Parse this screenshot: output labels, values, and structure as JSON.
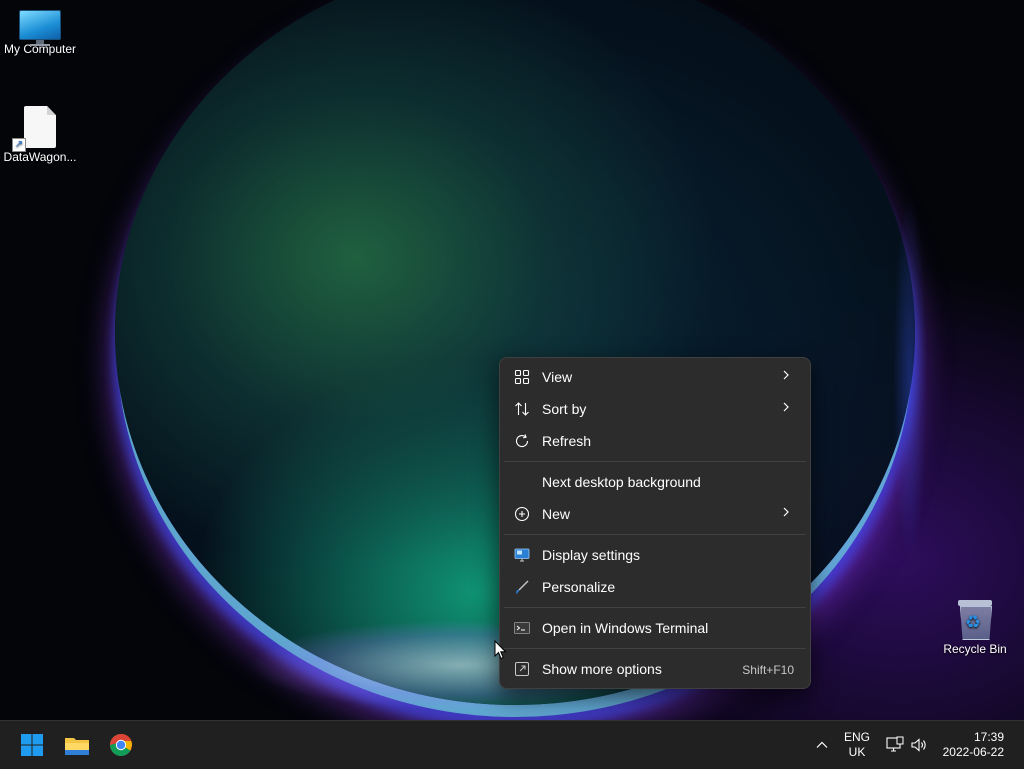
{
  "desktop": {
    "icons": [
      {
        "name": "My Computer",
        "label": "My Computer"
      },
      {
        "name": "DataWagon shortcut",
        "label": "DataWagon..."
      },
      {
        "name": "Recycle Bin",
        "label": "Recycle Bin"
      }
    ]
  },
  "context_menu": {
    "items": [
      {
        "label": "View",
        "icon": "grid-icon",
        "submenu": true
      },
      {
        "label": "Sort by",
        "icon": "sort-icon",
        "submenu": true
      },
      {
        "label": "Refresh",
        "icon": "refresh-icon",
        "submenu": false
      },
      {
        "label": "Next desktop background",
        "icon": "",
        "submenu": false
      },
      {
        "label": "New",
        "icon": "plus-circle-icon",
        "submenu": true
      },
      {
        "label": "Display settings",
        "icon": "display-icon",
        "submenu": false
      },
      {
        "label": "Personalize",
        "icon": "brush-icon",
        "submenu": false
      },
      {
        "label": "Open in Windows Terminal",
        "icon": "terminal-icon",
        "submenu": false
      },
      {
        "label": "Show more options",
        "icon": "more-options-icon",
        "submenu": false,
        "shortcut": "Shift+F10"
      }
    ]
  },
  "taskbar": {
    "apps": [
      "Start",
      "File Explorer",
      "Google Chrome"
    ],
    "tray": {
      "language_line1": "ENG",
      "language_line2": "UK",
      "time": "17:39",
      "date": "2022-06-22"
    }
  },
  "colors": {
    "menu_bg": "#2c2c2c",
    "taskbar_bg": "#202020",
    "start_blue": "#1f9bf0"
  }
}
